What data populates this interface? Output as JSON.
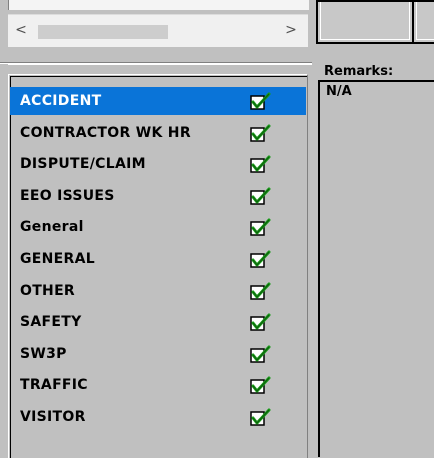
{
  "hscroll": {
    "left_arrow": "<",
    "right_arrow": ">"
  },
  "categories": [
    {
      "label": "ACCIDENT",
      "checked": true,
      "selected": true
    },
    {
      "label": "CONTRACTOR WK HR",
      "checked": true,
      "selected": false
    },
    {
      "label": "DISPUTE/CLAIM",
      "checked": true,
      "selected": false
    },
    {
      "label": "EEO ISSUES",
      "checked": true,
      "selected": false
    },
    {
      "label": "General",
      "checked": true,
      "selected": false
    },
    {
      "label": "GENERAL",
      "checked": true,
      "selected": false
    },
    {
      "label": "OTHER",
      "checked": true,
      "selected": false
    },
    {
      "label": "SAFETY",
      "checked": true,
      "selected": false
    },
    {
      "label": "SW3P",
      "checked": true,
      "selected": false
    },
    {
      "label": "TRAFFIC",
      "checked": true,
      "selected": false
    },
    {
      "label": "VISITOR",
      "checked": true,
      "selected": false
    }
  ],
  "remarks": {
    "label": "Remarks:",
    "value": "N/A"
  },
  "colors": {
    "selection": "#0a74d8",
    "check": "#1a9a1a",
    "background": "#c0c0c0"
  }
}
